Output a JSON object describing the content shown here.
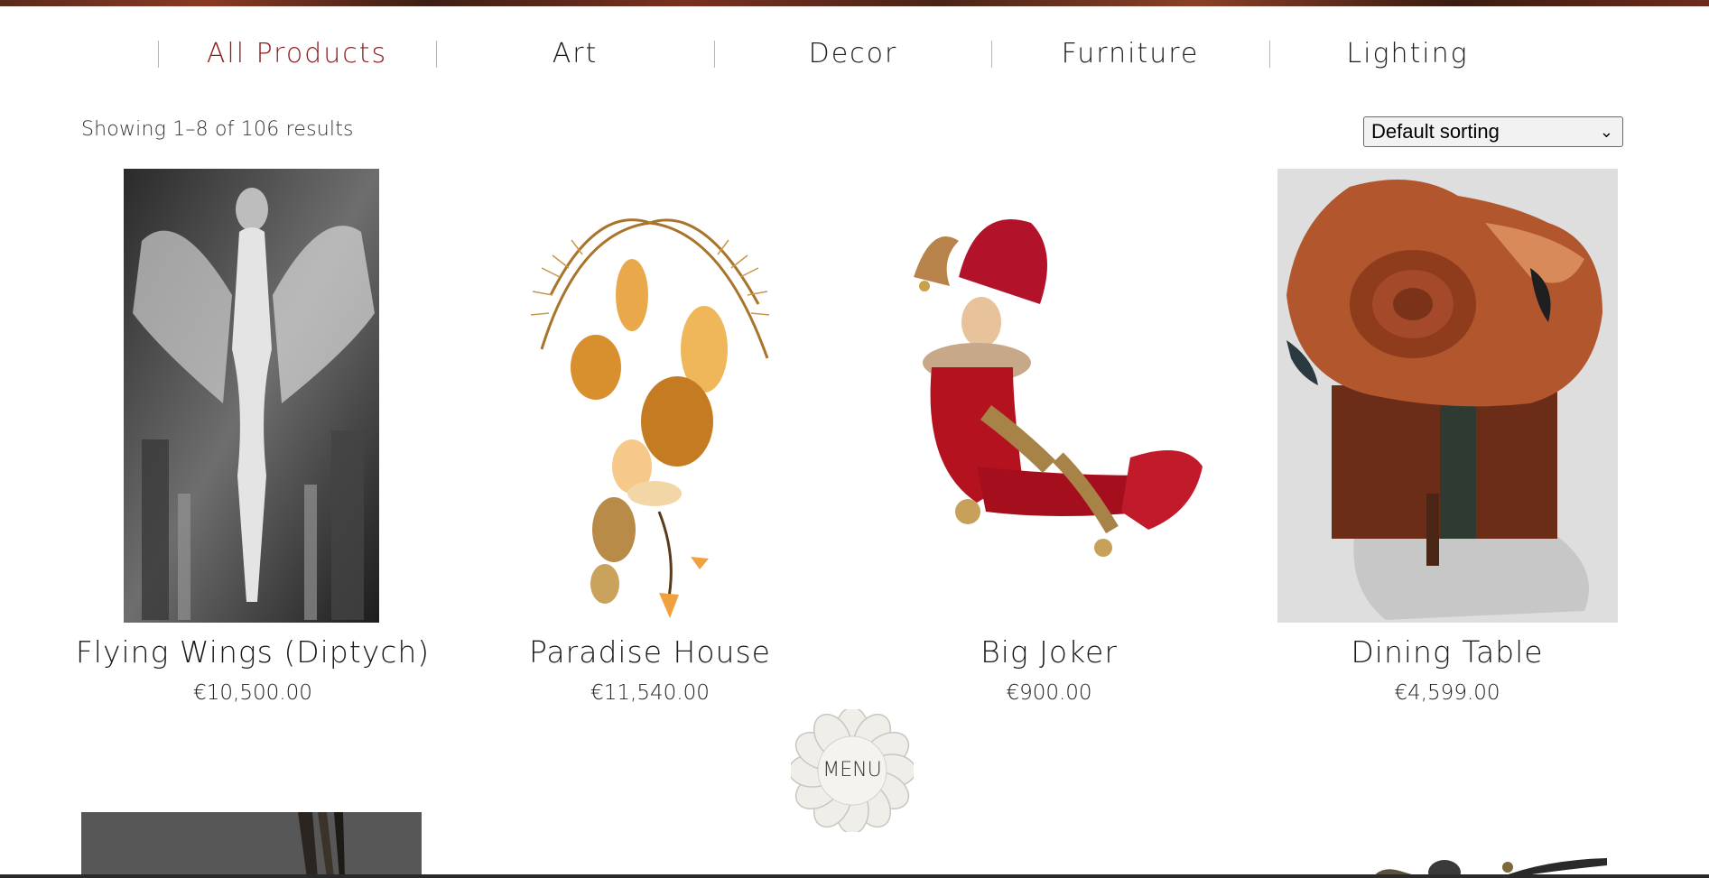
{
  "categories": [
    {
      "label": "All Products",
      "active": true
    },
    {
      "label": "Art",
      "active": false
    },
    {
      "label": "Decor",
      "active": false
    },
    {
      "label": "Furniture",
      "active": false
    },
    {
      "label": "Lighting",
      "active": false
    }
  ],
  "results_text": "Showing 1–8 of 106 results",
  "sorting": {
    "selected": "Default sorting"
  },
  "products": [
    {
      "name": "Flying Wings (Diptych)",
      "price": "€10,500.00"
    },
    {
      "name": "Paradise House",
      "price": "€11,540.00"
    },
    {
      "name": "Big Joker",
      "price": "€900.00"
    },
    {
      "name": "Dining Table",
      "price": "€4,599.00"
    }
  ],
  "menu_button": {
    "label": "MENU"
  },
  "colors": {
    "accent": "#8a1f1f",
    "text": "#1c1c1c",
    "separator": "#b5b5b5"
  }
}
